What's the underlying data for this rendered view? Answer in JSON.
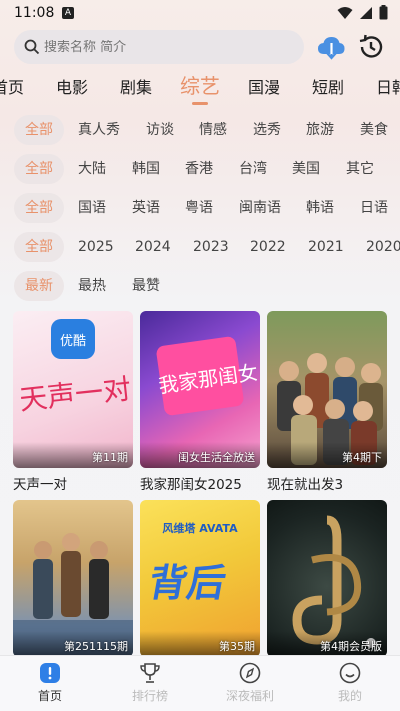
{
  "status": {
    "time": "11:08",
    "notif_glyph": "A"
  },
  "search": {
    "placeholder": "搜索名称 简介"
  },
  "categories": [
    "首页",
    "电影",
    "剧集",
    "综艺",
    "国漫",
    "短剧",
    "日韩"
  ],
  "filters": {
    "type": [
      "全部",
      "真人秀",
      "访谈",
      "情感",
      "选秀",
      "旅游",
      "美食"
    ],
    "region": [
      "全部",
      "大陆",
      "韩国",
      "香港",
      "台湾",
      "美国",
      "其它"
    ],
    "language": [
      "全部",
      "国语",
      "英语",
      "粤语",
      "闽南语",
      "韩语",
      "日语"
    ],
    "year": [
      "全部",
      "2025",
      "2024",
      "2023",
      "2022",
      "2021",
      "2020"
    ],
    "sort": [
      "最新",
      "最热",
      "最赞"
    ]
  },
  "cards": [
    {
      "title": "天声一对",
      "episode": "第11期",
      "poster_art": "天声一对",
      "logo": "优酷",
      "colors": [
        "#f9e7ef",
        "#f3b6cf"
      ]
    },
    {
      "title": "我家那闺女2025",
      "episode": "闺女生活全放送",
      "poster_art": "我家那闺女",
      "colors": [
        "#6a3fb0",
        "#e86bb6"
      ]
    },
    {
      "title": "现在就出发3",
      "episode": "第4期下",
      "colors": [
        "#6e7d58",
        "#b8a37a"
      ]
    },
    {
      "title": "",
      "episode": "第251115期",
      "colors": [
        "#c9a46b",
        "#6f88a8"
      ]
    },
    {
      "title": "",
      "episode": "第35期",
      "poster_art": "背后",
      "logo": "风维塔 AVATA",
      "colors": [
        "#f8d24b",
        "#2f6fd8"
      ]
    },
    {
      "title": "",
      "episode": "第4期会员版",
      "colors": [
        "#1e2a2a",
        "#6b5a3a"
      ]
    }
  ],
  "nav": [
    {
      "label": "首页",
      "icon": "home-icon",
      "active": true
    },
    {
      "label": "排行榜",
      "icon": "trophy-icon",
      "active": false
    },
    {
      "label": "深夜福利",
      "icon": "compass-icon",
      "active": false
    },
    {
      "label": "我的",
      "icon": "smiley-icon",
      "active": false
    }
  ],
  "colors": {
    "accent": "#e8926b",
    "download": "#4a90e2"
  }
}
